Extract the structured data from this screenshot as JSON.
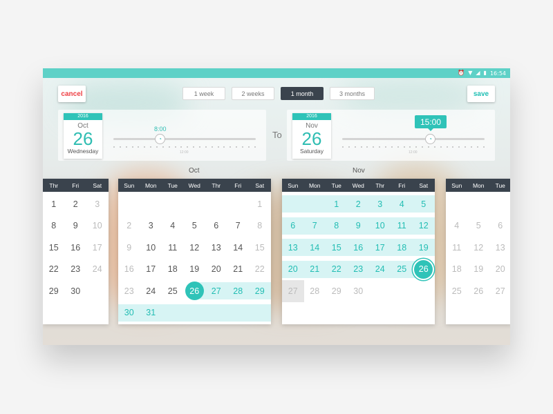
{
  "status": {
    "time": "16:54"
  },
  "toolbar": {
    "cancel_label": "cancel",
    "save_label": "save",
    "ranges": [
      "1 week",
      "2 weeks",
      "1 month",
      "3 months"
    ],
    "active_range": "1 month"
  },
  "start": {
    "year": "2016",
    "month": "Oct",
    "day": "26",
    "weekday": "Wednesday",
    "time": "8:00",
    "tick_label": "12:00"
  },
  "end": {
    "year": "2016",
    "month": "Nov",
    "day": "26",
    "weekday": "Saturday",
    "time": "15:00",
    "tick_label": "12:00"
  },
  "to_label": "To",
  "calendars": {
    "sep": {
      "weekdays": [
        "Thr",
        "Fri",
        "Sat"
      ],
      "rows": [
        [
          "1",
          "2",
          "3"
        ],
        [
          "8",
          "9",
          "10"
        ],
        [
          "15",
          "16",
          "17"
        ],
        [
          "22",
          "23",
          "24"
        ],
        [
          "29",
          "30",
          ""
        ]
      ]
    },
    "oct": {
      "name": "Oct",
      "weekdays": [
        "Sun",
        "Mon",
        "Tue",
        "Wed",
        "Thr",
        "Fri",
        "Sat"
      ],
      "rows": [
        [
          "",
          "",
          "",
          "",
          "",
          "",
          "1"
        ],
        [
          "2",
          "3",
          "4",
          "5",
          "6",
          "7",
          "8"
        ],
        [
          "9",
          "10",
          "11",
          "12",
          "13",
          "14",
          "15"
        ],
        [
          "16",
          "17",
          "18",
          "19",
          "20",
          "21",
          "22"
        ],
        [
          "23",
          "24",
          "25",
          "26",
          "27",
          "28",
          "29"
        ],
        [
          "30",
          "31",
          "",
          "",
          "",
          "",
          ""
        ]
      ]
    },
    "nov": {
      "name": "Nov",
      "weekdays": [
        "Sun",
        "Mon",
        "Tue",
        "Wed",
        "Thr",
        "Fri",
        "Sat"
      ],
      "rows": [
        [
          "",
          "",
          "1",
          "2",
          "3",
          "4",
          "5"
        ],
        [
          "6",
          "7",
          "8",
          "9",
          "10",
          "11",
          "12"
        ],
        [
          "13",
          "14",
          "15",
          "16",
          "17",
          "18",
          "19"
        ],
        [
          "20",
          "21",
          "22",
          "23",
          "24",
          "25",
          "26"
        ],
        [
          "27",
          "28",
          "29",
          "30",
          "",
          "",
          ""
        ]
      ]
    },
    "dec": {
      "weekdays": [
        "Sun",
        "Mon",
        "Tue"
      ],
      "rows": [
        [
          "",
          "",
          ""
        ],
        [
          "4",
          "5",
          "6"
        ],
        [
          "11",
          "12",
          "13"
        ],
        [
          "18",
          "19",
          "20"
        ],
        [
          "25",
          "26",
          "27"
        ]
      ]
    }
  },
  "colors": {
    "accent": "#2fc3b8",
    "header": "#3a434d",
    "range_fill": "#d7f4f4",
    "cancel": "#ee3e43"
  }
}
